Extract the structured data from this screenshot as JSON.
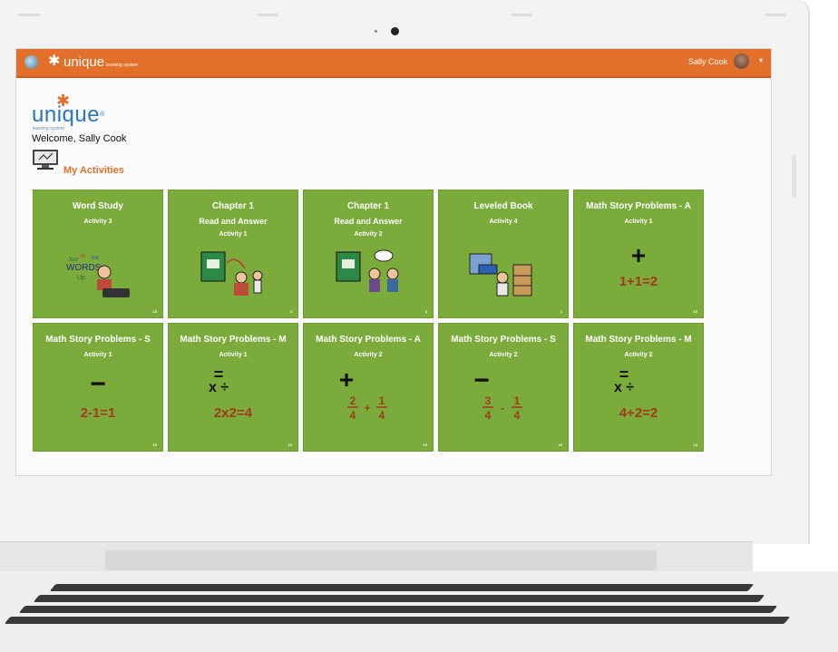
{
  "app": {
    "brand": "unique",
    "brand_sub": "learning system",
    "user_name": "Sally Cook",
    "caret": "▾",
    "logo": "unique",
    "logo_tm": "®",
    "logo_sub": "learning system",
    "welcome": "Welcome, Sally Cook",
    "section_title": "My Activities"
  },
  "icons": [
    "globe-icon",
    "asterisk-logo-icon",
    "avatar",
    "caret-down-icon",
    "computer-activity-icon"
  ],
  "colors": {
    "topbar": "#e2702a",
    "tile": "#7aab3b",
    "accent": "#e2702a",
    "brand_blue": "#2a76b8",
    "equation": "#a13a1c"
  },
  "tiles": [
    {
      "name": "Word Study",
      "sub": "Activity 3",
      "count": "15",
      "art": "words-up"
    },
    {
      "name": "Chapter 1",
      "sub": "Read and Answer",
      "sub2": "Activity 1",
      "count": "3",
      "art": "book-reading"
    },
    {
      "name": "Chapter 1",
      "sub": "Read and Answer",
      "sub2": "Activity 2",
      "count": "3",
      "art": "book-discussion"
    },
    {
      "name": "Leveled Book",
      "sub": "Activity 4",
      "count": "1",
      "art": "library"
    },
    {
      "name": "Math Story Problems - A",
      "sub": "Activity 1",
      "count": "10",
      "symbol": "+",
      "equation": "1+1=2"
    },
    {
      "name": "Math Story Problems - S",
      "sub": "Activity 1",
      "count": "10",
      "symbol": "−",
      "equation": "2-1=1"
    },
    {
      "name": "Math Story Problems - M",
      "sub": "Activity 1",
      "count": "10",
      "symbol": "=",
      "symbol2": "x ÷",
      "equation": "2x2=4"
    },
    {
      "name": "Math Story Problems - A",
      "sub": "Activity 2",
      "count": "10",
      "symbol": "+",
      "fraction": {
        "a": "2",
        "b": "4",
        "op": "+",
        "c": "1",
        "d": "4"
      }
    },
    {
      "name": "Math Story Problems - S",
      "sub": "Activity 2",
      "count": "10",
      "symbol": "−",
      "fraction": {
        "a": "3",
        "b": "4",
        "op": "-",
        "c": "1",
        "d": "4"
      }
    },
    {
      "name": "Math Story Problems - M",
      "sub": "Activity 2",
      "count": "10",
      "symbol": "=",
      "symbol2": "x ÷",
      "equation": "4+2=2"
    }
  ]
}
